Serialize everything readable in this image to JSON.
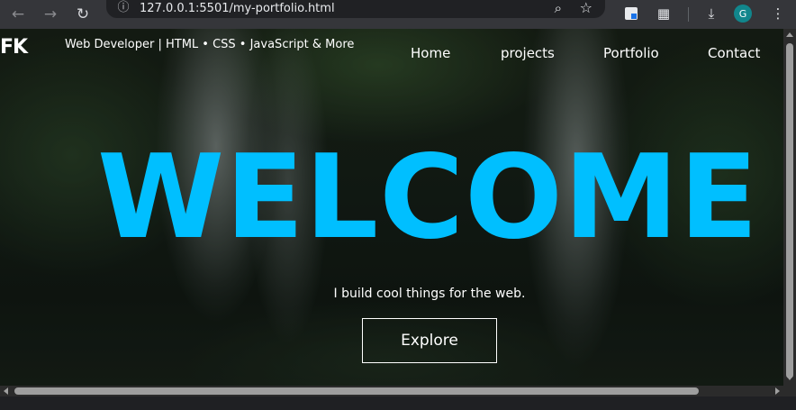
{
  "browser": {
    "url": "127.0.0.1:5501/my-portfolio.html",
    "profile_initial": "G",
    "icons": {
      "back": "arrow-left-icon",
      "forward": "arrow-right-icon",
      "reload": "reload-icon",
      "site_info": "info-icon",
      "zoom": "zoom-icon",
      "bookmark": "star-icon",
      "extension": "extension-icon",
      "puzzle": "puzzle-icon",
      "download": "download-icon",
      "menu": "kebab-menu-icon"
    }
  },
  "page": {
    "logo": "FK",
    "tagline": "Web Developer | HTML • CSS • JavaScript & More",
    "nav": [
      "Home",
      "projects",
      "Portfolio",
      "Contact"
    ],
    "hero": {
      "heading": "WELCOME",
      "subtitle": "I build cool things for the web.",
      "button": "Explore"
    },
    "colors": {
      "accent": "#00bfff",
      "text": "#ffffff"
    }
  }
}
